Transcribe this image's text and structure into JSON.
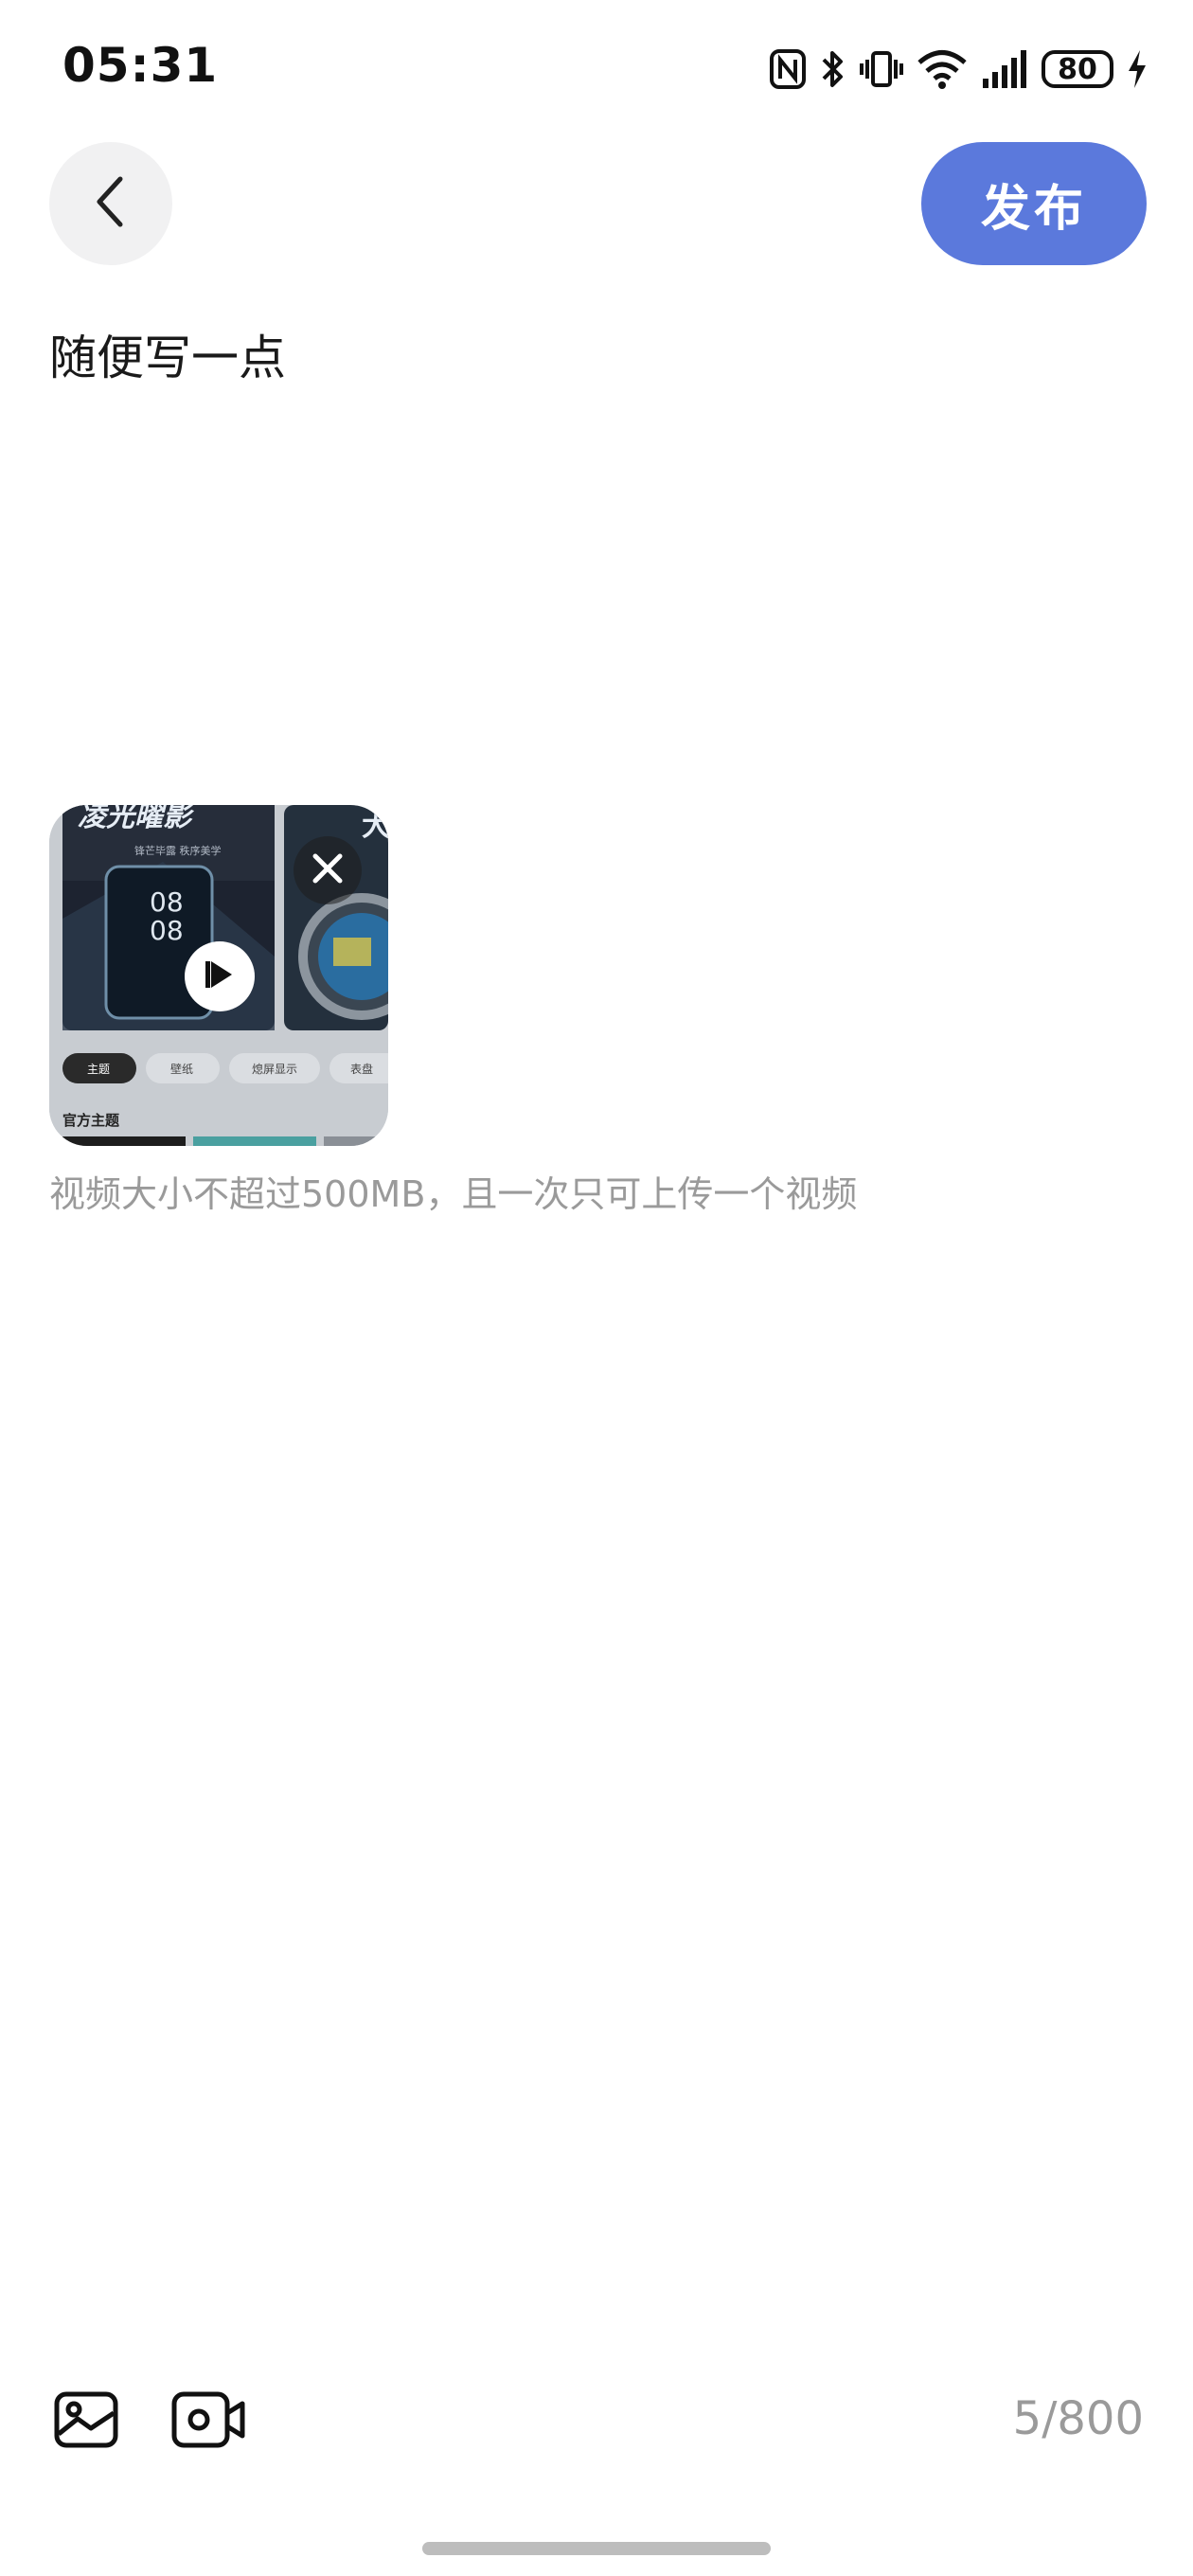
{
  "status_bar": {
    "time": "05:31",
    "battery": "80"
  },
  "header": {
    "publish_label": "发布"
  },
  "post": {
    "text": "随便写一点"
  },
  "video_attachment": {
    "thumbnail_texts": {
      "banner_left": "凌光曜影",
      "banner_sub": "锋芒毕露 秩序美学",
      "clock_top": "08",
      "clock_bottom": "08",
      "banner_right": "大",
      "chip_theme": "主题",
      "chip_wallpaper": "壁纸",
      "chip_aod": "熄屏显示",
      "chip_watch": "表盘",
      "section_title": "官方主题"
    },
    "hint": "视频大小不超过500MB，且一次只可上传一个视频"
  },
  "toolbar": {
    "counter": "5/800"
  },
  "icons": [
    "back-icon",
    "image-icon",
    "video-camera-icon",
    "close-icon",
    "play-icon",
    "nfc-icon",
    "bluetooth-icon",
    "vibrate-icon",
    "wifi-icon",
    "signal-icon",
    "charging-icon"
  ]
}
